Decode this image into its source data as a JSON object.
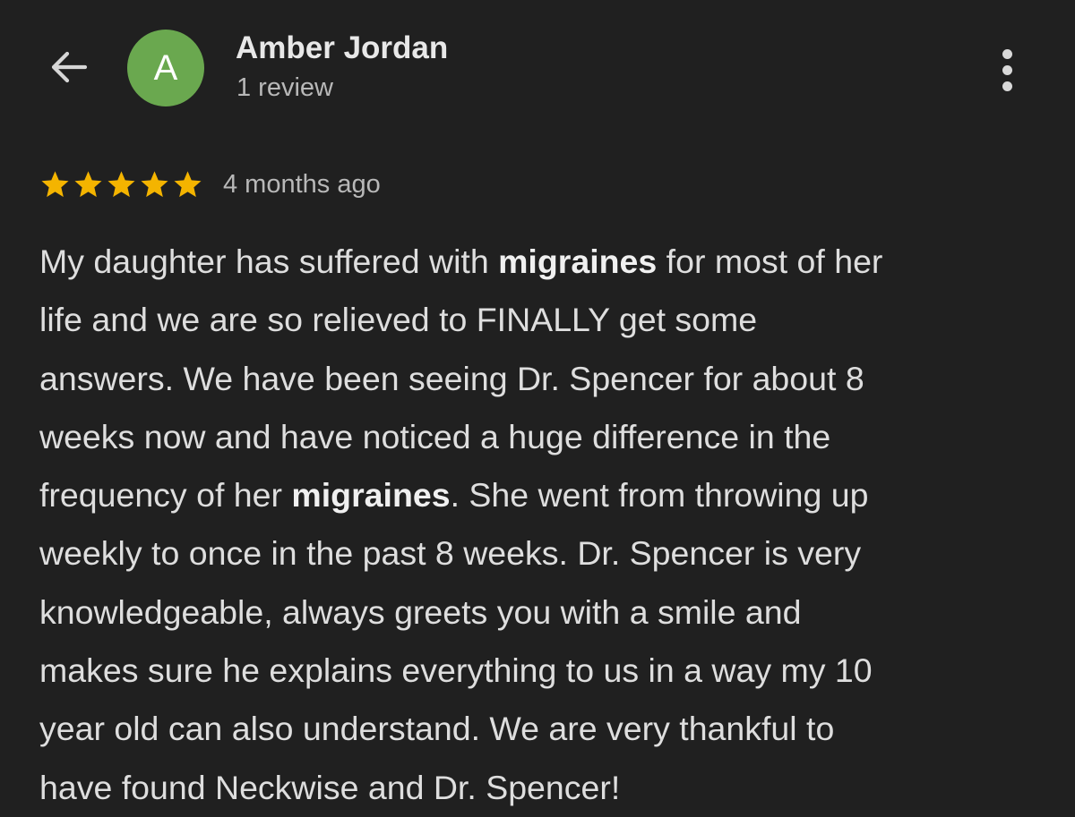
{
  "header": {
    "back_icon": "arrow-back-icon",
    "avatar_initial": "A",
    "avatar_color": "#6aa84f",
    "reviewer_name": "Amber Jordan",
    "review_count": "1 review",
    "menu_icon": "more-vert-icon"
  },
  "review": {
    "rating": 5,
    "rating_max": 5,
    "star_icon": "star-icon",
    "star_color": "#f4b400",
    "timestamp": "4 months ago",
    "highlight_term": "migraines",
    "lines": [
      [
        "My daughter has suffered with ",
        "migraines",
        " for most of her"
      ],
      [
        "life and we are so relieved to FINALLY get some"
      ],
      [
        "answers. We have been seeing Dr. Spencer for about 8"
      ],
      [
        "weeks now and have noticed a huge difference in the"
      ],
      [
        "frequency of her ",
        "migraines",
        ". She went from throwing up"
      ],
      [
        "weekly to once in the past 8 weeks. Dr. Spencer is very"
      ],
      [
        "knowledgeable, always greets you with a smile and"
      ],
      [
        "makes sure he explains everything to us in a way my 10"
      ],
      [
        "year old can also understand. We are very thankful to"
      ],
      [
        "have found Neckwise and Dr. Spencer!"
      ]
    ]
  }
}
